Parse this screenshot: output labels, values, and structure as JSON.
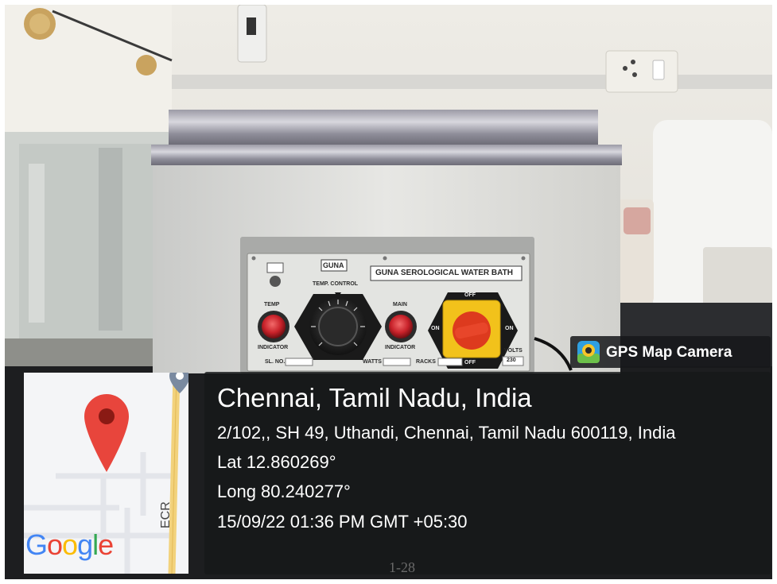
{
  "panel": {
    "brand": "GUNA",
    "title": "GUNA SEROLOGICAL WATER BATH",
    "temp_control": "TEMP. CONTROL",
    "temp_label": "TEMP",
    "indicator_left": "INDICATOR",
    "main_label": "MAIN",
    "indicator_right": "INDICATOR",
    "off_top": "OFF",
    "off_bottom": "OFF",
    "on_left": "ON",
    "on_right": "ON",
    "volts": "VOLTS",
    "volts_value": "230",
    "sl_no": "SL. NO.",
    "watts": "WATTS",
    "racks": "RACKS"
  },
  "camera_badge": {
    "label": "GPS Map Camera"
  },
  "location": {
    "city": "Chennai, Tamil Nadu, India",
    "address": "2/102,, SH 49, Uthandi, Chennai, Tamil Nadu 600119, India",
    "latitude": "Lat 12.860269°",
    "longitude": "Long 80.240277°",
    "datetime": "15/09/22 01:36 PM GMT +05:30"
  },
  "map": {
    "logo": "Google",
    "road_label": "ECR",
    "pin_color": "#e8453c"
  },
  "floor_marking": "1-28"
}
